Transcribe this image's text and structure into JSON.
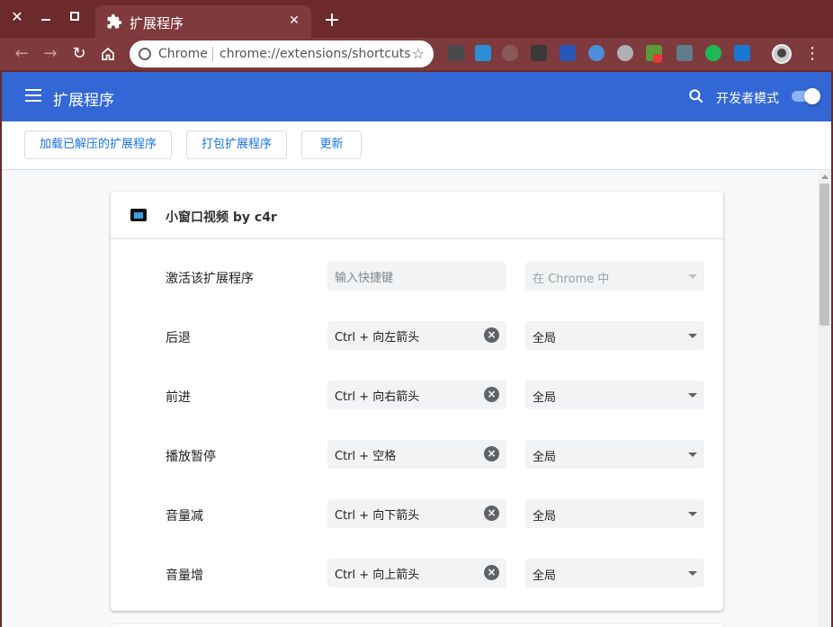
{
  "window": {
    "tab_title": "扩展程序",
    "new_tab_symbol": "+",
    "close_symbol": "✕"
  },
  "omnibox": {
    "site_label": "Chrome",
    "url": "chrome://extensions/shortcuts"
  },
  "header": {
    "title": "扩展程序",
    "dev_mode_label": "开发者模式",
    "dev_mode_on": true
  },
  "actions": {
    "load_unpacked": "加载已解压的扩展程序",
    "pack": "打包扩展程序",
    "update": "更新"
  },
  "extension": {
    "name": "小窗口视频 by c4r",
    "shortcuts": [
      {
        "label": "激活该扩展程序",
        "value": "",
        "placeholder": "输入快捷键",
        "scope": "在 Chrome 中",
        "scope_disabled": true
      },
      {
        "label": "后退",
        "value": "Ctrl + 向左箭头",
        "scope": "全局"
      },
      {
        "label": "前进",
        "value": "Ctrl + 向右箭头",
        "scope": "全局"
      },
      {
        "label": "播放暂停",
        "value": "Ctrl + 空格",
        "scope": "全局"
      },
      {
        "label": "音量减",
        "value": "Ctrl + 向下箭头",
        "scope": "全局"
      },
      {
        "label": "音量增",
        "value": "Ctrl + 向上箭头",
        "scope": "全局"
      }
    ]
  },
  "colors": {
    "header_bg": "#3367d6",
    "titlebar_bg": "#6d2a2d",
    "accent_text": "#1a73e8"
  }
}
